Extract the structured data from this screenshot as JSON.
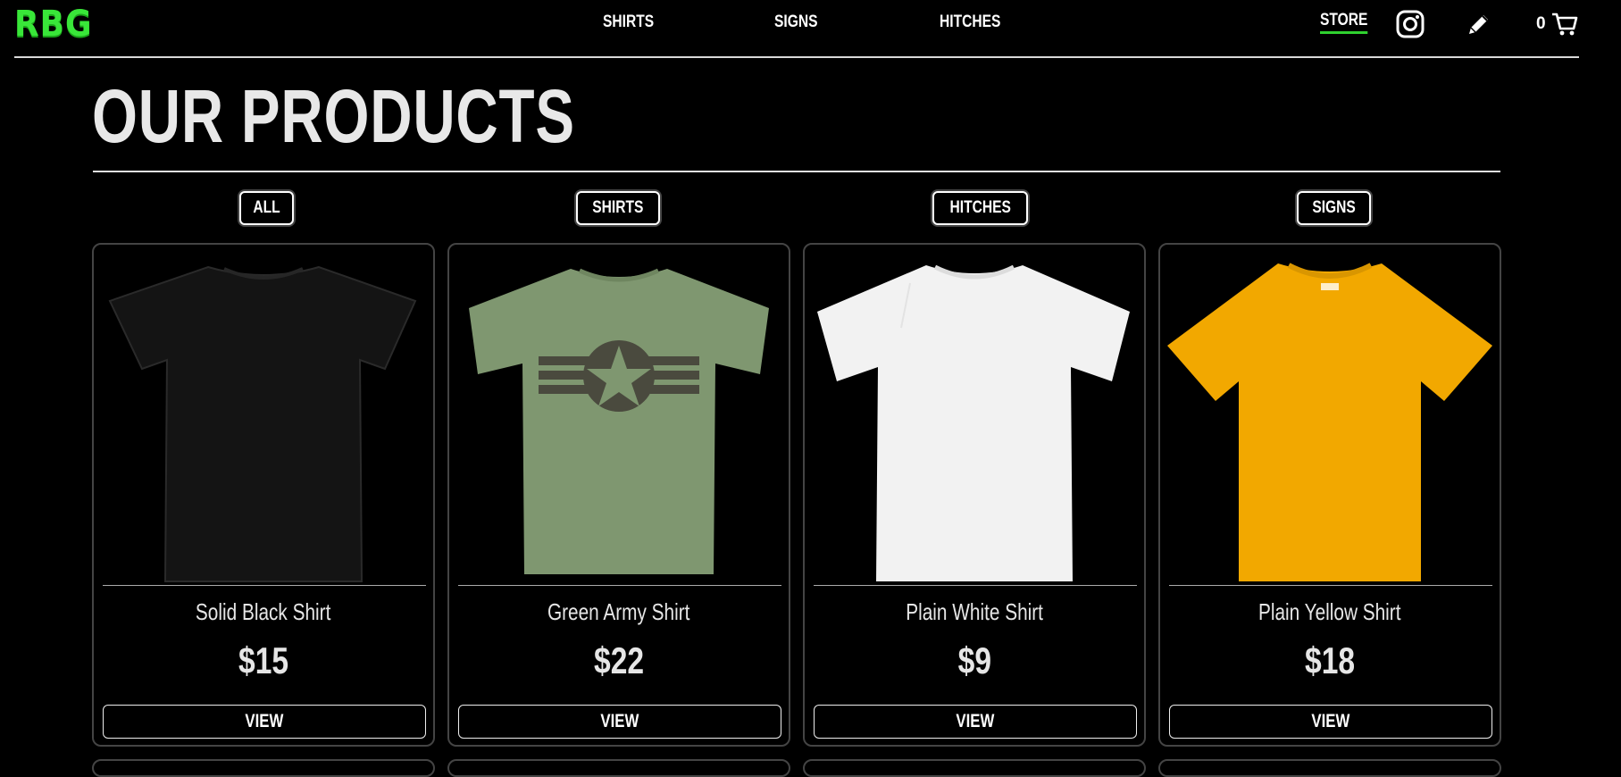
{
  "header": {
    "logo": "RBG",
    "nav": [
      "SHIRTS",
      "SIGNS",
      "HITCHES"
    ],
    "store_label": "STORE",
    "cart_count": "0",
    "icons": [
      "instagram-icon",
      "pencil-icon",
      "cart-icon"
    ],
    "accent_color": "#2fd12f"
  },
  "main": {
    "title": "OUR PRODUCTS",
    "filters": [
      "ALL",
      "SHIRTS",
      "HITCHES",
      "SIGNS"
    ],
    "products": [
      {
        "name": "Solid Black Shirt",
        "price": "$15",
        "view_label": "VIEW",
        "shirt_color": "#141414"
      },
      {
        "name": "Green Army Shirt",
        "price": "$22",
        "view_label": "VIEW",
        "shirt_color": "#7f9770"
      },
      {
        "name": "Plain White Shirt",
        "price": "$9",
        "view_label": "VIEW",
        "shirt_color": "#f2f2f2"
      },
      {
        "name": "Plain Yellow Shirt",
        "price": "$18",
        "view_label": "VIEW",
        "shirt_color": "#f2a800"
      }
    ]
  }
}
